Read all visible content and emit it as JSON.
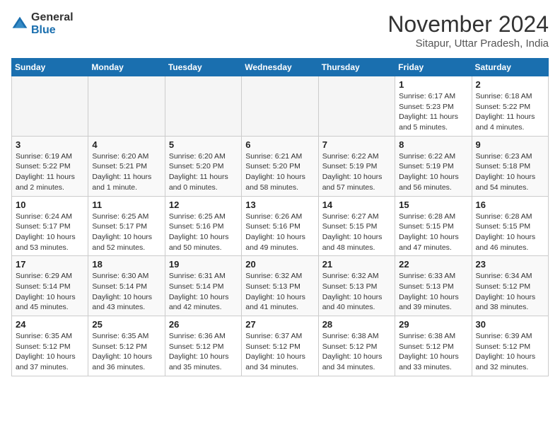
{
  "header": {
    "logo_general": "General",
    "logo_blue": "Blue",
    "month": "November 2024",
    "location": "Sitapur, Uttar Pradesh, India"
  },
  "weekdays": [
    "Sunday",
    "Monday",
    "Tuesday",
    "Wednesday",
    "Thursday",
    "Friday",
    "Saturday"
  ],
  "weeks": [
    [
      {
        "day": "",
        "info": ""
      },
      {
        "day": "",
        "info": ""
      },
      {
        "day": "",
        "info": ""
      },
      {
        "day": "",
        "info": ""
      },
      {
        "day": "",
        "info": ""
      },
      {
        "day": "1",
        "info": "Sunrise: 6:17 AM\nSunset: 5:23 PM\nDaylight: 11 hours and 5 minutes."
      },
      {
        "day": "2",
        "info": "Sunrise: 6:18 AM\nSunset: 5:22 PM\nDaylight: 11 hours and 4 minutes."
      }
    ],
    [
      {
        "day": "3",
        "info": "Sunrise: 6:19 AM\nSunset: 5:22 PM\nDaylight: 11 hours and 2 minutes."
      },
      {
        "day": "4",
        "info": "Sunrise: 6:20 AM\nSunset: 5:21 PM\nDaylight: 11 hours and 1 minute."
      },
      {
        "day": "5",
        "info": "Sunrise: 6:20 AM\nSunset: 5:20 PM\nDaylight: 11 hours and 0 minutes."
      },
      {
        "day": "6",
        "info": "Sunrise: 6:21 AM\nSunset: 5:20 PM\nDaylight: 10 hours and 58 minutes."
      },
      {
        "day": "7",
        "info": "Sunrise: 6:22 AM\nSunset: 5:19 PM\nDaylight: 10 hours and 57 minutes."
      },
      {
        "day": "8",
        "info": "Sunrise: 6:22 AM\nSunset: 5:19 PM\nDaylight: 10 hours and 56 minutes."
      },
      {
        "day": "9",
        "info": "Sunrise: 6:23 AM\nSunset: 5:18 PM\nDaylight: 10 hours and 54 minutes."
      }
    ],
    [
      {
        "day": "10",
        "info": "Sunrise: 6:24 AM\nSunset: 5:17 PM\nDaylight: 10 hours and 53 minutes."
      },
      {
        "day": "11",
        "info": "Sunrise: 6:25 AM\nSunset: 5:17 PM\nDaylight: 10 hours and 52 minutes."
      },
      {
        "day": "12",
        "info": "Sunrise: 6:25 AM\nSunset: 5:16 PM\nDaylight: 10 hours and 50 minutes."
      },
      {
        "day": "13",
        "info": "Sunrise: 6:26 AM\nSunset: 5:16 PM\nDaylight: 10 hours and 49 minutes."
      },
      {
        "day": "14",
        "info": "Sunrise: 6:27 AM\nSunset: 5:15 PM\nDaylight: 10 hours and 48 minutes."
      },
      {
        "day": "15",
        "info": "Sunrise: 6:28 AM\nSunset: 5:15 PM\nDaylight: 10 hours and 47 minutes."
      },
      {
        "day": "16",
        "info": "Sunrise: 6:28 AM\nSunset: 5:15 PM\nDaylight: 10 hours and 46 minutes."
      }
    ],
    [
      {
        "day": "17",
        "info": "Sunrise: 6:29 AM\nSunset: 5:14 PM\nDaylight: 10 hours and 45 minutes."
      },
      {
        "day": "18",
        "info": "Sunrise: 6:30 AM\nSunset: 5:14 PM\nDaylight: 10 hours and 43 minutes."
      },
      {
        "day": "19",
        "info": "Sunrise: 6:31 AM\nSunset: 5:14 PM\nDaylight: 10 hours and 42 minutes."
      },
      {
        "day": "20",
        "info": "Sunrise: 6:32 AM\nSunset: 5:13 PM\nDaylight: 10 hours and 41 minutes."
      },
      {
        "day": "21",
        "info": "Sunrise: 6:32 AM\nSunset: 5:13 PM\nDaylight: 10 hours and 40 minutes."
      },
      {
        "day": "22",
        "info": "Sunrise: 6:33 AM\nSunset: 5:13 PM\nDaylight: 10 hours and 39 minutes."
      },
      {
        "day": "23",
        "info": "Sunrise: 6:34 AM\nSunset: 5:12 PM\nDaylight: 10 hours and 38 minutes."
      }
    ],
    [
      {
        "day": "24",
        "info": "Sunrise: 6:35 AM\nSunset: 5:12 PM\nDaylight: 10 hours and 37 minutes."
      },
      {
        "day": "25",
        "info": "Sunrise: 6:35 AM\nSunset: 5:12 PM\nDaylight: 10 hours and 36 minutes."
      },
      {
        "day": "26",
        "info": "Sunrise: 6:36 AM\nSunset: 5:12 PM\nDaylight: 10 hours and 35 minutes."
      },
      {
        "day": "27",
        "info": "Sunrise: 6:37 AM\nSunset: 5:12 PM\nDaylight: 10 hours and 34 minutes."
      },
      {
        "day": "28",
        "info": "Sunrise: 6:38 AM\nSunset: 5:12 PM\nDaylight: 10 hours and 34 minutes."
      },
      {
        "day": "29",
        "info": "Sunrise: 6:38 AM\nSunset: 5:12 PM\nDaylight: 10 hours and 33 minutes."
      },
      {
        "day": "30",
        "info": "Sunrise: 6:39 AM\nSunset: 5:12 PM\nDaylight: 10 hours and 32 minutes."
      }
    ]
  ]
}
